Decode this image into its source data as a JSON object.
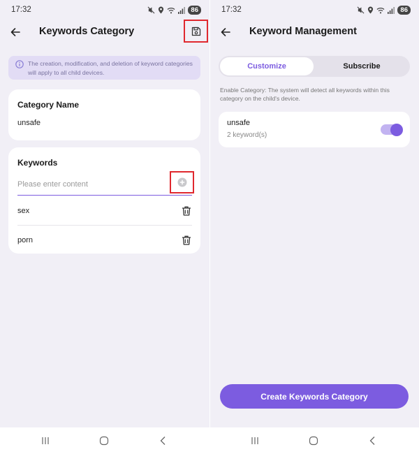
{
  "status": {
    "time": "17:32",
    "battery": "86"
  },
  "left_screen": {
    "title": "Keywords Category",
    "notice": "The creation, modification, and deletion of keyword categories will apply to all child devices.",
    "category_name": {
      "label": "Category Name",
      "value": "unsafe"
    },
    "keywords": {
      "label": "Keywords",
      "placeholder": "Please enter content",
      "items": [
        "sex",
        "porn"
      ]
    }
  },
  "right_screen": {
    "title": "Keyword Management",
    "tabs": [
      "Customize",
      "Subscribe"
    ],
    "active_tab": "Customize",
    "enable_text": "Enable Category: The system will detect all keywords within this category on the child's device.",
    "category": {
      "name": "unsafe",
      "count": "2 keyword(s)",
      "enabled": true
    },
    "create_button": "Create Keywords Category"
  },
  "icons": {
    "back": "back-arrow-icon",
    "save": "save-icon",
    "add": "add-circle-icon",
    "delete": "trash-icon",
    "info": "info-icon"
  },
  "colors": {
    "accent": "#7c5ce0",
    "background": "#f1eff6",
    "notice_bg": "#e2dcf5",
    "highlight_box": "#e0282e"
  }
}
